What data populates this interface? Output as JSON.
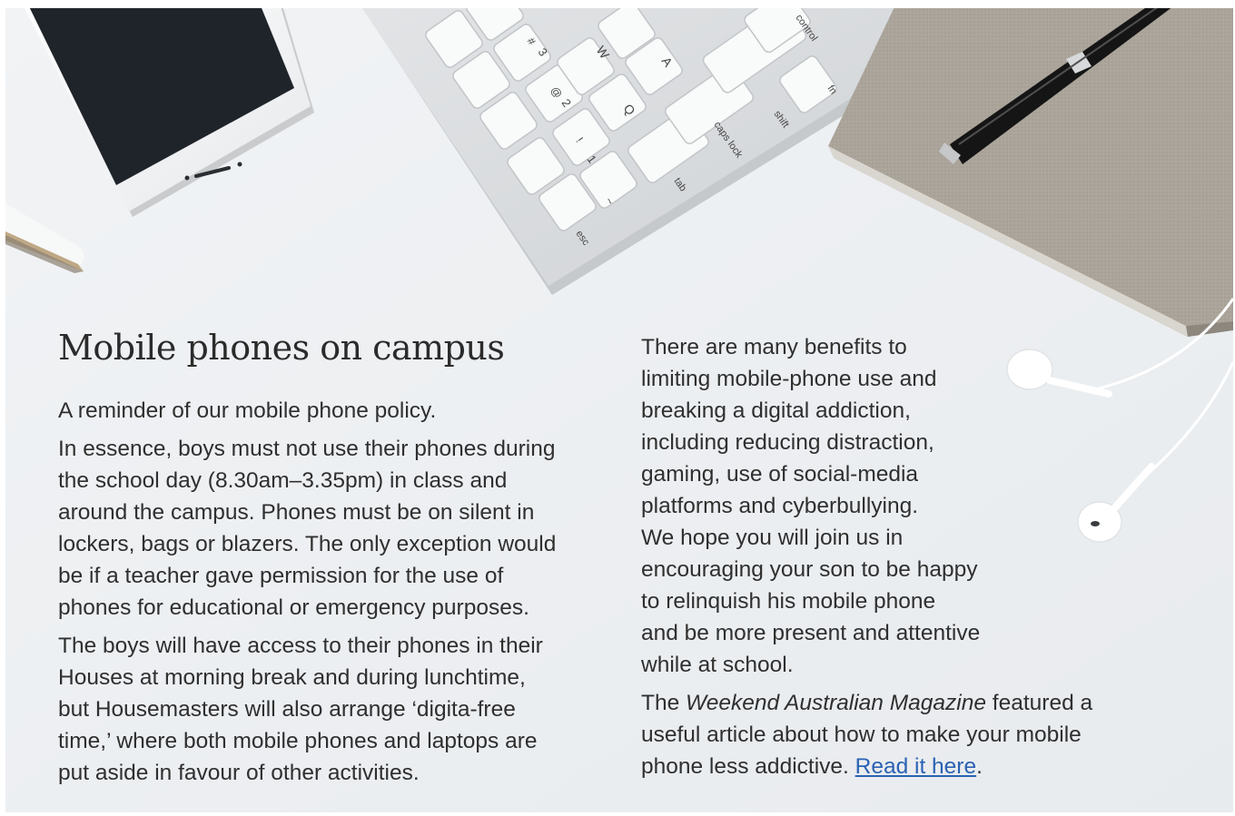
{
  "article": {
    "title": "Mobile phones on campus",
    "intro": "A reminder of our mobile phone policy.",
    "para1_lines": [
      "In essence, boys must not use their phones during",
      "the school day (8.30am–3.35pm) in class and",
      "around the campus. Phones must be on silent in",
      "lockers, bags or blazers. The only exception would",
      "be if a teacher gave permission for the use of",
      "phones for educational or emergency purposes."
    ],
    "para2_lines": [
      "The boys will have access to their phones in their",
      "Houses at morning break and during lunchtime,",
      "but Housemasters will also arrange ‘digita-free",
      "time,’ where both mobile phones and laptops are",
      "put aside in favour of other activities."
    ],
    "para3_lines": [
      "There are many benefits to",
      "limiting mobile-phone use and",
      "breaking a digital addiction,",
      "including reducing distraction,",
      "gaming, use of social-media",
      "platforms and cyberbullying.",
      "We hope you will join us in",
      "encouraging your son to be happy",
      "to relinquish his mobile phone",
      "and be more present and attentive",
      "while at school."
    ],
    "para4": {
      "line1_prefix": "The ",
      "magazine": "Weekend Australian Magazine",
      "line1_suffix": " featured a",
      "line2": "useful article about how to make your mobile",
      "line3_prefix": "phone less addictive. ",
      "link_text": "Read it here",
      "line3_suffix": "."
    }
  },
  "hero": {
    "objects": [
      "smartphone-icon",
      "keyboard-icon",
      "notebook-icon",
      "pen-icon",
      "earphones-icon"
    ],
    "keycaps": {
      "esc": "esc",
      "tab": "tab",
      "caps": "caps lock",
      "shift": "shift",
      "control": "control",
      "fn": "fn",
      "q": "Q",
      "w": "W",
      "a": "A",
      "one": "1",
      "two": "2",
      "three": "3",
      "excl": "!",
      "at": "@",
      "hash": "#",
      "tilde": "~"
    }
  },
  "colors": {
    "background": "#eef0f2",
    "text": "#2f2f2f",
    "heading": "#2b2b2b",
    "link": "#2a62b3"
  }
}
